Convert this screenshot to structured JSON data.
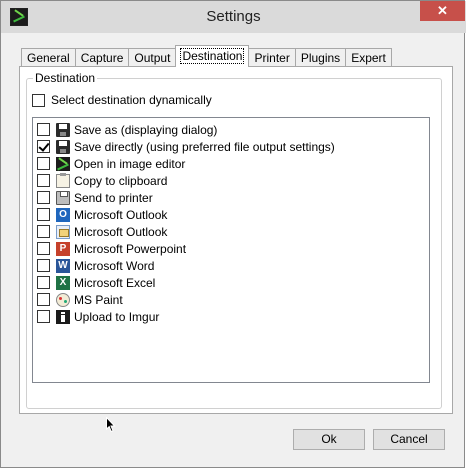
{
  "window": {
    "title": "Settings",
    "close_glyph": "✕"
  },
  "tabs": [
    {
      "label": "General",
      "active": false
    },
    {
      "label": "Capture",
      "active": false
    },
    {
      "label": "Output",
      "active": false
    },
    {
      "label": "Destination",
      "active": true
    },
    {
      "label": "Printer",
      "active": false
    },
    {
      "label": "Plugins",
      "active": false
    },
    {
      "label": "Expert",
      "active": false
    }
  ],
  "destination": {
    "group_label": "Destination",
    "dynamic_label": "Select destination dynamically",
    "dynamic_checked": false,
    "items": [
      {
        "label": "Save as (displaying dialog)",
        "icon": "floppy-icon",
        "checked": false
      },
      {
        "label": "Save directly (using preferred file output settings)",
        "icon": "floppy-icon",
        "checked": true
      },
      {
        "label": "Open in image editor",
        "icon": "image-editor-icon",
        "checked": false
      },
      {
        "label": "Copy to clipboard",
        "icon": "clipboard-icon",
        "checked": false
      },
      {
        "label": "Send to printer",
        "icon": "printer-icon",
        "checked": false
      },
      {
        "label": "Microsoft Outlook",
        "icon": "outlook-icon",
        "glyph": "O",
        "checked": false
      },
      {
        "label": "Microsoft Outlook",
        "icon": "outlook-mail-icon",
        "checked": false
      },
      {
        "label": "Microsoft Powerpoint",
        "icon": "powerpoint-icon",
        "glyph": "P",
        "checked": false
      },
      {
        "label": "Microsoft Word",
        "icon": "word-icon",
        "glyph": "W",
        "checked": false
      },
      {
        "label": "Microsoft Excel",
        "icon": "excel-icon",
        "glyph": "X",
        "checked": false
      },
      {
        "label": "MS Paint",
        "icon": "paint-icon",
        "checked": false
      },
      {
        "label": "Upload to Imgur",
        "icon": "imgur-icon",
        "checked": false
      }
    ]
  },
  "buttons": {
    "ok": "Ok",
    "cancel": "Cancel"
  }
}
